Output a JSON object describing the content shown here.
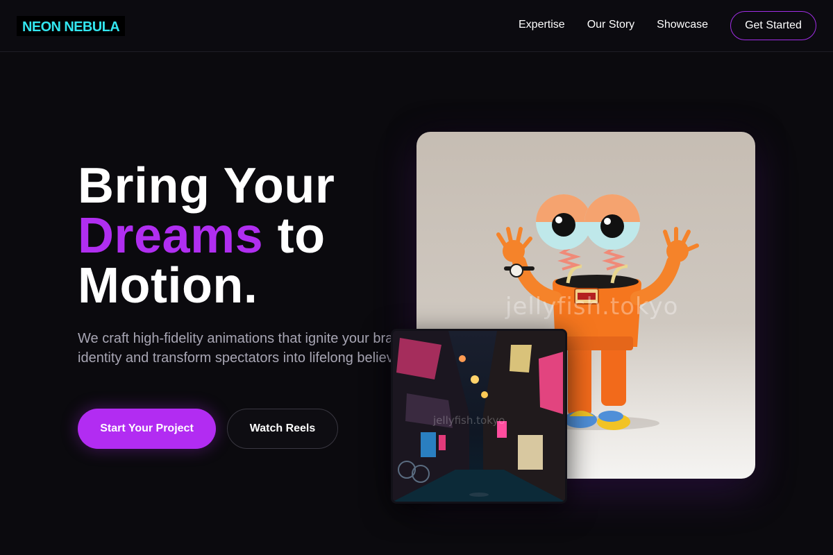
{
  "brand": {
    "logo": "NEON NEBULA"
  },
  "nav": {
    "links": [
      "Expertise",
      "Our Story",
      "Showcase"
    ],
    "cta": "Get Started"
  },
  "hero": {
    "headline_line1": "Bring Your",
    "headline_accent": "Dreams",
    "headline_after_accent": " to",
    "headline_line3": "Motion.",
    "subtext": "We craft high-fidelity animations that ignite your brand identity and transform spectators into lifelong believers.",
    "primary_button": "Start Your Project",
    "secondary_button": "Watch Reels"
  },
  "media": {
    "main_image_watermark": "jellyfish.tokyo",
    "small_image_watermark": "jellyfish.tokyo",
    "main_image_icon": "orange-character-image",
    "small_image_icon": "neon-alley-image"
  },
  "colors": {
    "background": "#0b0a0e",
    "accent_purple": "#b22cf2",
    "logo_cyan": "#33e6f0",
    "subtext_gray": "#a8a6b4"
  }
}
